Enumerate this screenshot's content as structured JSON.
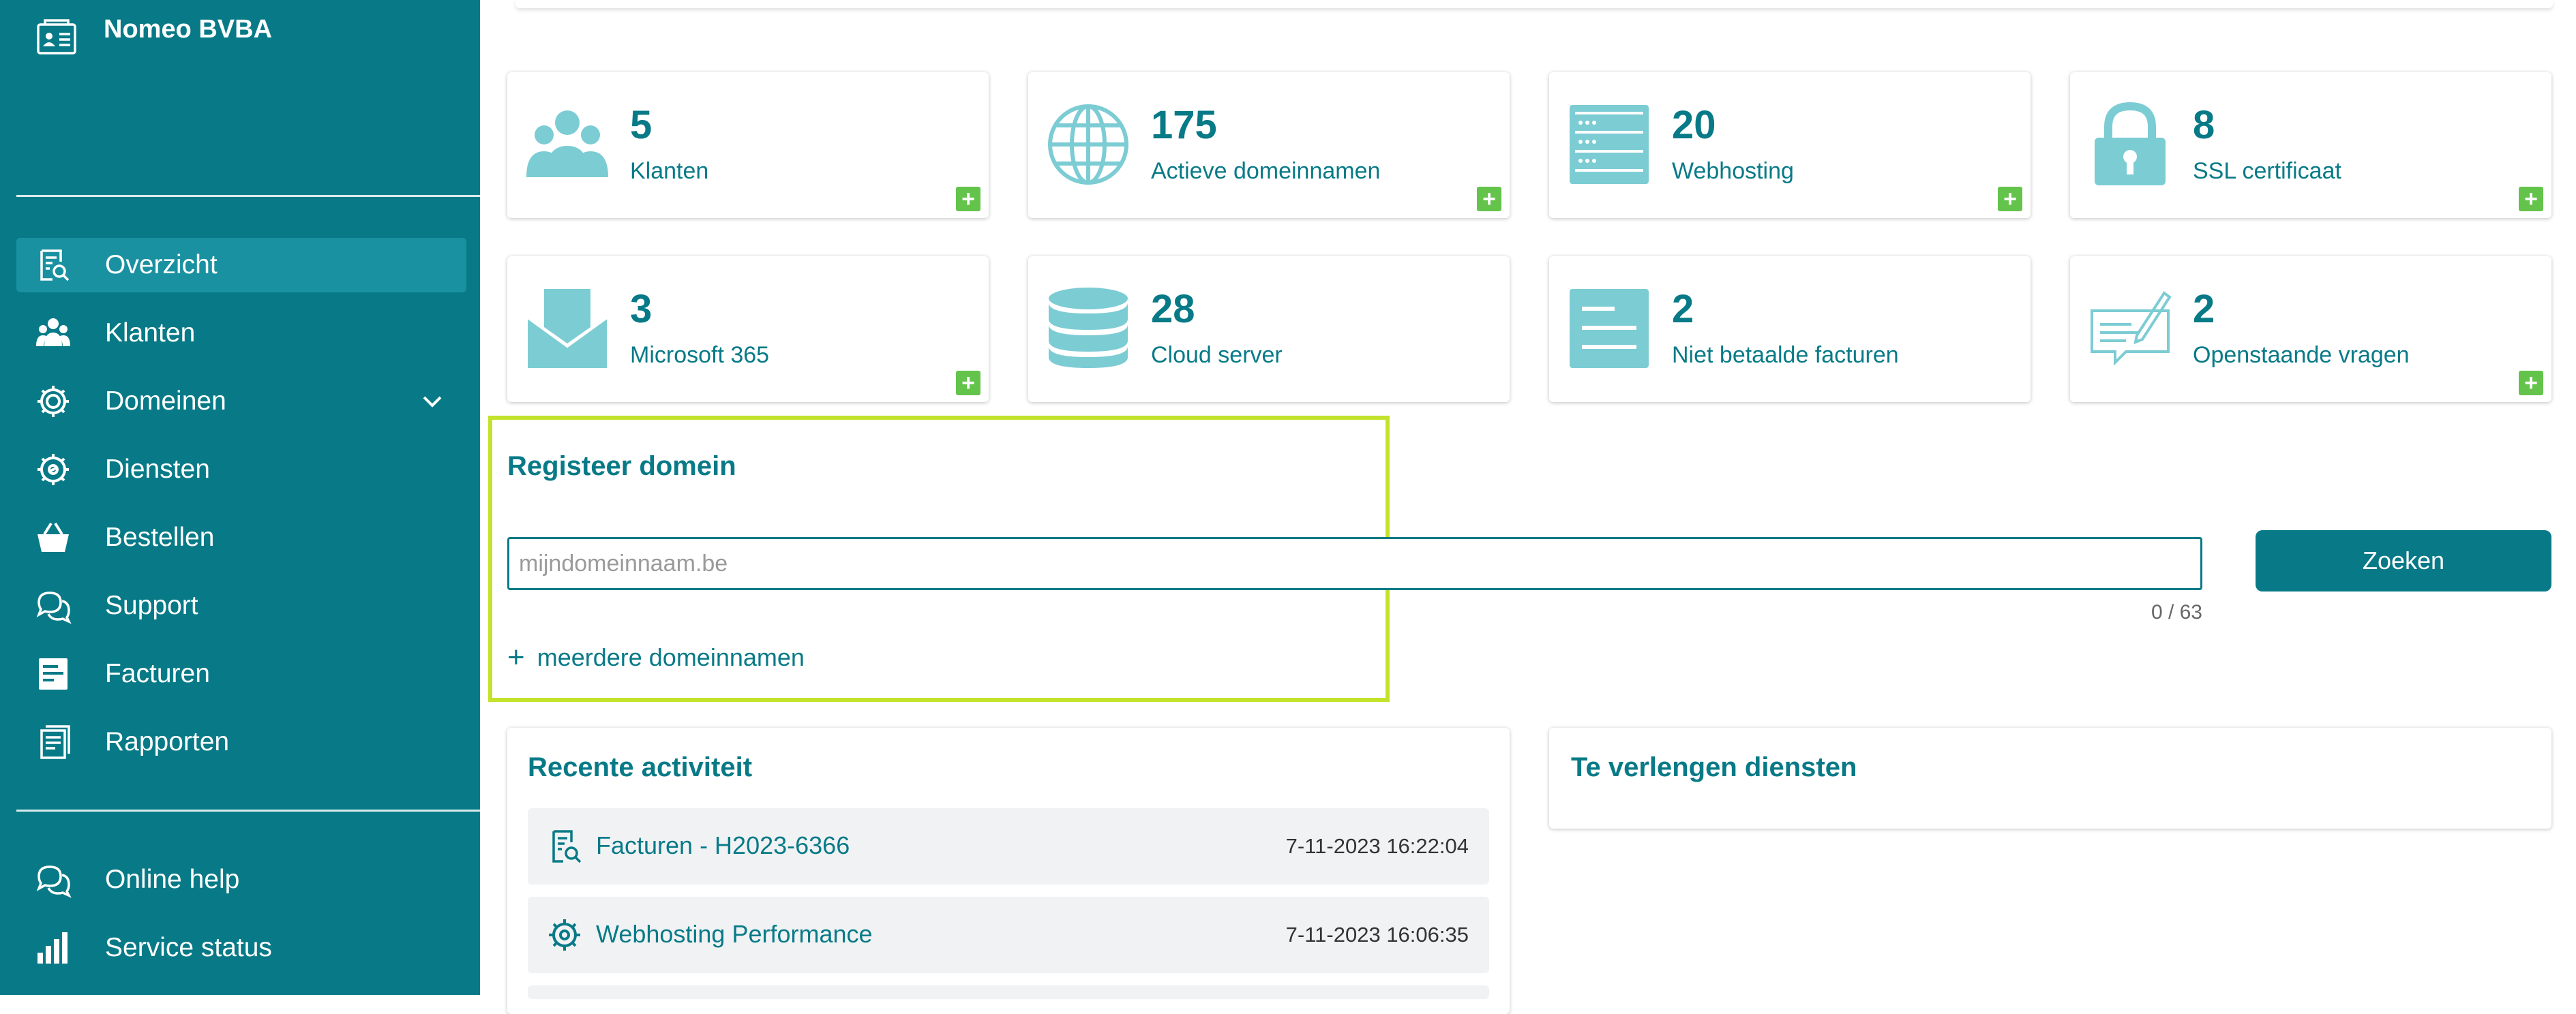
{
  "sidebar": {
    "company": "Nomeo BVBA",
    "company_icon": "id-card-icon",
    "nav": [
      {
        "label": "Overzicht",
        "icon": "overview-icon",
        "active": true
      },
      {
        "label": "Klanten",
        "icon": "users-icon"
      },
      {
        "label": "Domeinen",
        "icon": "gear-icon",
        "expandable": true
      },
      {
        "label": "Diensten",
        "icon": "gear-services-icon"
      },
      {
        "label": "Bestellen",
        "icon": "basket-icon"
      },
      {
        "label": "Support",
        "icon": "chat-icon"
      },
      {
        "label": "Facturen",
        "icon": "invoice-icon"
      },
      {
        "label": "Rapporten",
        "icon": "reports-icon"
      }
    ],
    "footer": [
      {
        "label": "Online help",
        "icon": "help-chat-icon"
      },
      {
        "label": "Service status",
        "icon": "bar-chart-icon"
      }
    ]
  },
  "cards": [
    {
      "value": "5",
      "label": "Klanten",
      "icon": "users-icon"
    },
    {
      "value": "175",
      "label": "Actieve domeinnamen",
      "icon": "globe-icon"
    },
    {
      "value": "20",
      "label": "Webhosting",
      "icon": "server-icon"
    },
    {
      "value": "8",
      "label": "SSL certificaat",
      "icon": "lock-icon"
    },
    {
      "value": "3",
      "label": "Microsoft 365",
      "icon": "mail-icon"
    },
    {
      "value": "28",
      "label": "Cloud server",
      "icon": "database-icon"
    },
    {
      "value": "2",
      "label": "Niet betaalde facturen",
      "icon": "document-icon"
    },
    {
      "value": "2",
      "label": "Openstaande vragen",
      "icon": "question-chat-icon"
    }
  ],
  "register": {
    "title": "Registeer domein",
    "placeholder": "mijndomeinnaam.be",
    "counter": "0 / 63",
    "more": "meerdere domeinnamen",
    "more_icon": "plus-icon",
    "button": "Zoeken"
  },
  "recent": {
    "title": "Recente activiteit",
    "items": [
      {
        "title": "Facturen - H2023-6366",
        "date": "7-11-2023 16:22:04",
        "icon": "invoice-search-icon"
      },
      {
        "title": "Webhosting Performance",
        "date": "7-11-2023 16:06:35",
        "icon": "gear-icon"
      }
    ]
  },
  "renew": {
    "title": "Te verlengen diensten"
  },
  "colors": {
    "primary": "#087a87",
    "active_nav": "#1a91a0",
    "icon_light": "#7cccd4",
    "plus_green": "#63c34b",
    "highlight": "#c3e22c"
  }
}
